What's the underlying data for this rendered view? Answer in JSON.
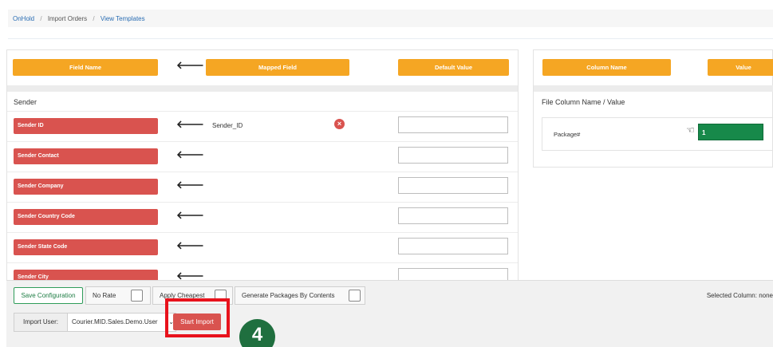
{
  "breadcrumb": {
    "root": "OnHold",
    "middle": "Import Orders",
    "current": "View Templates",
    "separator": "/"
  },
  "mapping_header": {
    "field_name": "Field Name",
    "mapped_field": "Mapped Field",
    "default_value": "Default Value",
    "arrow": "🡐"
  },
  "section": {
    "title": "Sender"
  },
  "rows": [
    {
      "field": "Sender ID",
      "mapped": "Sender_ID",
      "remove_icon": "×"
    },
    {
      "field": "Sender Contact",
      "mapped": ""
    },
    {
      "field": "Sender Company",
      "mapped": ""
    },
    {
      "field": "Sender Country Code",
      "mapped": ""
    },
    {
      "field": "Sender State Code",
      "mapped": ""
    },
    {
      "field": "Sender City",
      "mapped": ""
    }
  ],
  "right_panel": {
    "column_name": "Column Name",
    "value": "Value",
    "title": "File Column Name / Value",
    "package_label": "Package#",
    "package_value": "1",
    "hand_icon": "☜"
  },
  "bottom": {
    "save_config": "Save Configuration",
    "no_rate": "No Rate",
    "apply_cheapest": "Apply Cheapest",
    "generate_packages": "Generate Packages By Contents",
    "selected_column": "Selected Column: none",
    "import_user_label": "Import User:",
    "import_user_value": "Courier.MID.Sales.Demo.User",
    "caret": "⌄",
    "start_import": "Start Import"
  },
  "step_badge": "4",
  "colors": {
    "orange": "#f5a623",
    "red": "#d9534f",
    "green": "#17894a",
    "highlight": "#e8121c"
  }
}
